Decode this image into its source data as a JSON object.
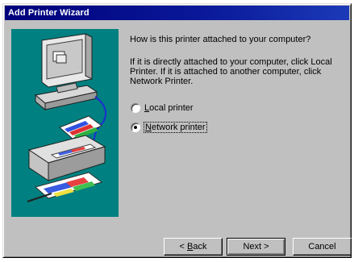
{
  "window": {
    "title": "Add Printer Wizard"
  },
  "main": {
    "question": "How is this printer attached to your computer?",
    "instructions": "If it is directly attached to your computer, click Local Printer. If it is attached to another computer, click Network Printer.",
    "options": [
      {
        "label": "Local printer",
        "mnemonic": "L",
        "rest": "ocal printer",
        "selected": false
      },
      {
        "label": "Network printer",
        "mnemonic": "N",
        "rest": "etwork printer",
        "selected": true
      }
    ]
  },
  "buttons": {
    "back_prefix": "< ",
    "back_mnemonic": "B",
    "back_rest": "ack",
    "next_label": "Next >",
    "cancel_label": "Cancel"
  },
  "colors": {
    "title_bar": "#00007b",
    "dialog_face": "#c0c0c0",
    "art_background": "#008080"
  },
  "icons": {
    "art": "computer-printer-illustration"
  }
}
